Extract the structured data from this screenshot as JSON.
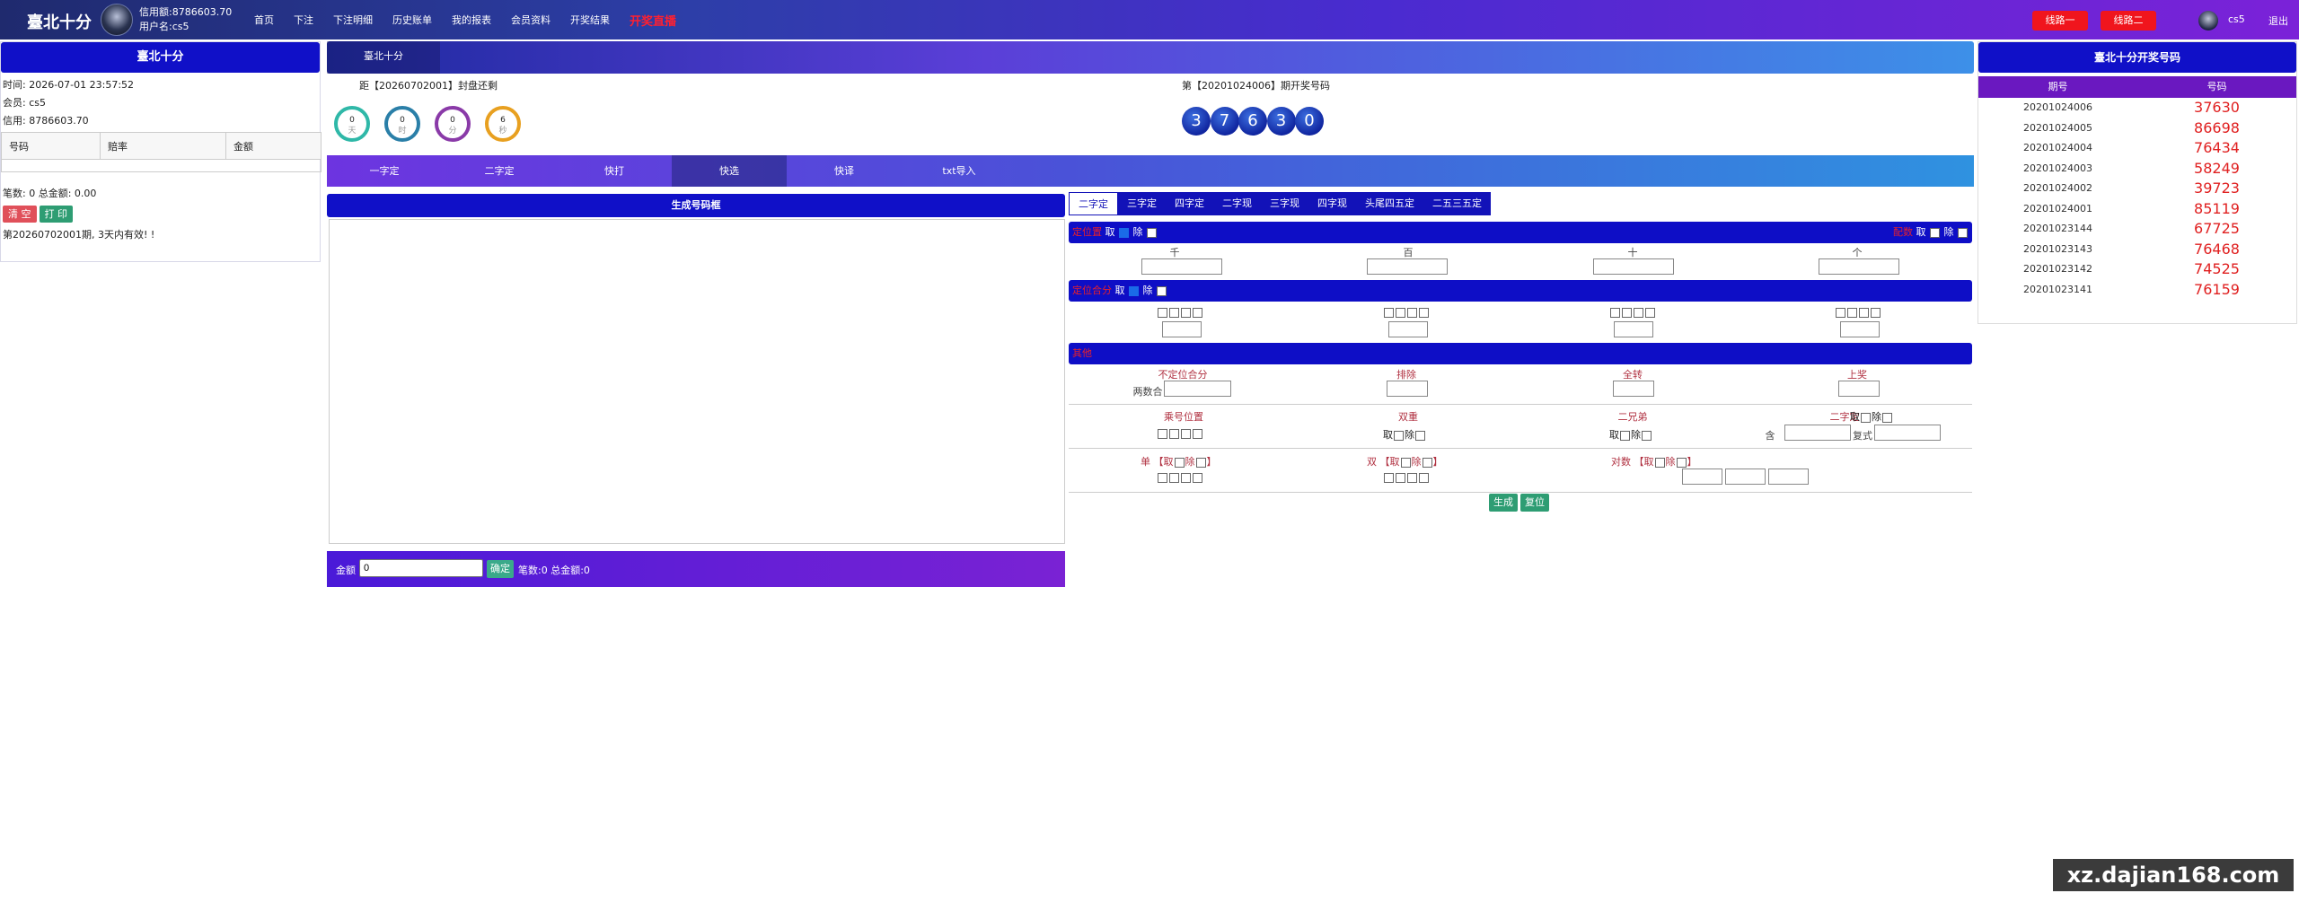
{
  "header": {
    "logo": "臺北十分",
    "credit": "信用额:8786603.70",
    "username": "用户名:cs5",
    "nav": [
      "首页",
      "下注",
      "下注明细",
      "历史账单",
      "我的报表",
      "会员资料",
      "开奖结果",
      "开奖直播"
    ],
    "line1": "线路一",
    "line2": "线路二",
    "user": "cs5",
    "exit": "退出"
  },
  "left": {
    "title": "臺北十分",
    "time": "时间:  2026-07-01 23:57:52",
    "member": "会员:  cs5",
    "credit": "信用:  8786603.70",
    "cols": [
      "号码",
      "赔率",
      "金额"
    ],
    "summary": "笔数:   0  总金额:    0.00",
    "clear": "清 空",
    "print": "打 印",
    "note": "第20260702001期, 3天内有效! !"
  },
  "middle": {
    "tab": "臺北十分",
    "countdown": "距【20260702001】封盘还剩",
    "rings": [
      {
        "top": "0",
        "bottom": "天",
        "color": "#2fb8a8"
      },
      {
        "top": "0",
        "bottom": "时",
        "color": "#2a7fa8"
      },
      {
        "top": "0",
        "bottom": "分",
        "color": "#8a3aa8"
      },
      {
        "top": "6",
        "bottom": "秒",
        "color": "#e8a020"
      }
    ],
    "draw_title": "第【20201024006】期开奖号码",
    "balls": [
      "3",
      "7",
      "6",
      "3",
      "0"
    ],
    "plays": [
      "一字定",
      "二字定",
      "快打",
      "快选",
      "快译",
      "txt导入"
    ],
    "active_play": "快选",
    "gen_title": "生成号码框",
    "amount_label": "金额",
    "amount_value": "0",
    "confirm": "确定",
    "stat": "笔数:0 总金额:0",
    "subtabs": [
      "二字定",
      "三字定",
      "四字定",
      "二字现",
      "三字现",
      "四字现",
      "头尾四五定",
      "二五三五定"
    ]
  },
  "form": {
    "s1_label": "定位置",
    "s1_take": "取",
    "s1_exclude": "除",
    "s1_right": "配数",
    "positions": [
      "千",
      "百",
      "十",
      "个"
    ],
    "s2_label": "定位合分",
    "s3_label": "其他",
    "row3": [
      "不定位合分",
      "排除",
      "全转",
      "上奖"
    ],
    "row3_extra": "两数合",
    "row4": [
      "乘号位置",
      "双重",
      "二兄弟",
      "二字定"
    ],
    "row4_extra_a": "含",
    "row4_extra_b": "复式",
    "row5": [
      "单",
      "双",
      "对数"
    ],
    "take": "取",
    "exclude": "除",
    "gen": "生成",
    "reset": "复位"
  },
  "right": {
    "title": "臺北十分开奖号码",
    "col_period": "期号",
    "col_number": "号码",
    "rows": [
      {
        "p": "20201024006",
        "n": "37630"
      },
      {
        "p": "20201024005",
        "n": "86698"
      },
      {
        "p": "20201024004",
        "n": "76434"
      },
      {
        "p": "20201024003",
        "n": "58249"
      },
      {
        "p": "20201024002",
        "n": "39723"
      },
      {
        "p": "20201024001",
        "n": "85119"
      },
      {
        "p": "20201023144",
        "n": "67725"
      },
      {
        "p": "20201023143",
        "n": "76468"
      },
      {
        "p": "20201023142",
        "n": "74525"
      },
      {
        "p": "20201023141",
        "n": "76159"
      }
    ]
  },
  "watermark": "xz.dajian168.com"
}
